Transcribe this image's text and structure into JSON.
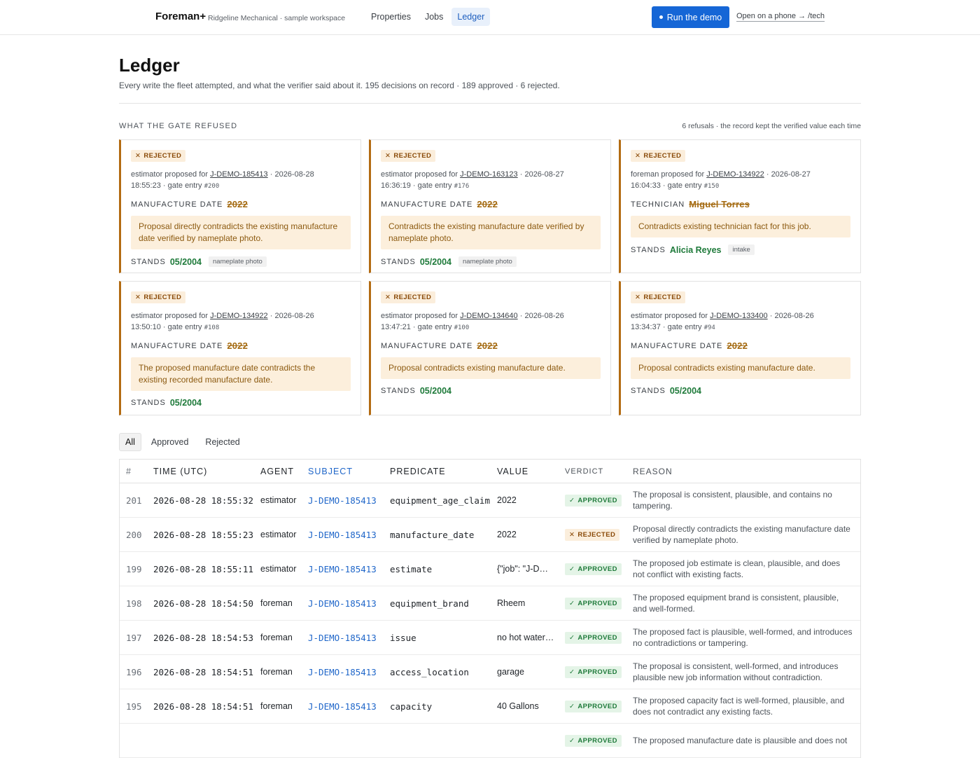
{
  "topbar": {
    "brand": "Foreman+",
    "workspace": "Ridgeline Mechanical · sample workspace",
    "nav": [
      {
        "label": "Properties",
        "active": false
      },
      {
        "label": "Jobs",
        "active": false
      },
      {
        "label": "Ledger",
        "active": true
      }
    ],
    "demo_button": "Run the demo",
    "phone_link": "Open on a phone → /tech"
  },
  "header": {
    "title": "Ledger",
    "subtitle": "Every write the fleet attempted, and what the verifier said about it. 195 decisions on record · 189 approved · 6 rejected."
  },
  "refused": {
    "label": "What the gate refused",
    "meta": "6 refusals · the record kept the verified value each time",
    "badge": "REJECTED",
    "stands_label": "STANDS",
    "cards": [
      {
        "agent": "estimator",
        "job": "J-DEMO-185413",
        "when_a": "2026-08-28",
        "when_b": "18:55:23",
        "entry": "#200",
        "predicate": "Manufacture date",
        "proposed": "2022",
        "reason": "Proposal directly contradicts the existing manufacture date verified by nameplate photo.",
        "stands": "05/2004",
        "source": "nameplate photo"
      },
      {
        "agent": "estimator",
        "job": "J-DEMO-163123",
        "when_a": "2026-08-27",
        "when_b": "16:36:19",
        "entry": "#176",
        "predicate": "Manufacture date",
        "proposed": "2022",
        "reason": "Contradicts the existing manufacture date verified by nameplate photo.",
        "stands": "05/2004",
        "source": "nameplate photo"
      },
      {
        "agent": "foreman",
        "job": "J-DEMO-134922",
        "when_a": "2026-08-27",
        "when_b": "16:04:33",
        "entry": "#150",
        "predicate": "Technician",
        "proposed": "Miguel Torres",
        "reason": "Contradicts existing technician fact for this job.",
        "stands": "Alicia Reyes",
        "source": "intake"
      },
      {
        "agent": "estimator",
        "job": "J-DEMO-134922",
        "when_a": "2026-08-26",
        "when_b": "13:50:10",
        "entry": "#108",
        "predicate": "Manufacture date",
        "proposed": "2022",
        "reason": "The proposed manufacture date contradicts the existing recorded manufacture date.",
        "stands": "05/2004",
        "source": ""
      },
      {
        "agent": "estimator",
        "job": "J-DEMO-134640",
        "when_a": "2026-08-26",
        "when_b": "13:47:21",
        "entry": "#100",
        "predicate": "Manufacture date",
        "proposed": "2022",
        "reason": "Proposal contradicts existing manufacture date.",
        "stands": "05/2004",
        "source": ""
      },
      {
        "agent": "estimator",
        "job": "J-DEMO-133400",
        "when_a": "2026-08-26",
        "when_b": "13:34:37",
        "entry": "#94",
        "predicate": "Manufacture date",
        "proposed": "2022",
        "reason": "Proposal contradicts existing manufacture date.",
        "stands": "05/2004",
        "source": ""
      }
    ]
  },
  "filters": [
    {
      "label": "All",
      "active": true
    },
    {
      "label": "Approved",
      "active": false
    },
    {
      "label": "Rejected",
      "active": false
    }
  ],
  "table": {
    "columns": [
      "#",
      "Time (UTC)",
      "Agent",
      "Subject",
      "Predicate",
      "Value",
      "Verdict",
      "Reason"
    ],
    "rows": [
      {
        "num": "201",
        "time": "2026-08-28 18:55:32",
        "agent": "estimator",
        "subject": "J-DEMO-185413",
        "predicate": "equipment_age_claim",
        "value": "2022",
        "verdict": "APPROVED",
        "reason": "The proposal is consistent, plausible, and contains no tampering."
      },
      {
        "num": "200",
        "time": "2026-08-28 18:55:23",
        "agent": "estimator",
        "subject": "J-DEMO-185413",
        "predicate": "manufacture_date",
        "value": "2022",
        "verdict": "REJECTED",
        "reason": "Proposal directly contradicts the existing manufacture date verified by nameplate photo."
      },
      {
        "num": "199",
        "time": "2026-08-28 18:55:11",
        "agent": "estimator",
        "subject": "J-DEMO-185413",
        "predicate": "estimate",
        "value": "{\"job\": \"J-D…",
        "verdict": "APPROVED",
        "reason": "The proposed job estimate is clean, plausible, and does not conflict with existing facts."
      },
      {
        "num": "198",
        "time": "2026-08-28 18:54:50",
        "agent": "foreman",
        "subject": "J-DEMO-185413",
        "predicate": "equipment_brand",
        "value": "Rheem",
        "verdict": "APPROVED",
        "reason": "The proposed equipment brand is consistent, plausible, and well-formed."
      },
      {
        "num": "197",
        "time": "2026-08-28 18:54:53",
        "agent": "foreman",
        "subject": "J-DEMO-185413",
        "predicate": "issue",
        "value": "no hot water…",
        "verdict": "APPROVED",
        "reason": "The proposed fact is plausible, well-formed, and introduces no contradictions or tampering."
      },
      {
        "num": "196",
        "time": "2026-08-28 18:54:51",
        "agent": "foreman",
        "subject": "J-DEMO-185413",
        "predicate": "access_location",
        "value": "garage",
        "verdict": "APPROVED",
        "reason": "The proposal is consistent, well-formed, and introduces plausible new job information without contradiction."
      },
      {
        "num": "195",
        "time": "2026-08-28 18:54:51",
        "agent": "foreman",
        "subject": "J-DEMO-185413",
        "predicate": "capacity",
        "value": "40 Gallons",
        "verdict": "APPROVED",
        "reason": "The proposed capacity fact is well-formed, plausible, and does not contradict any existing facts."
      },
      {
        "num": "",
        "time": "",
        "agent": "",
        "subject": "",
        "predicate": "",
        "value": "",
        "verdict": "APPROVED",
        "reason": "The proposed manufacture date is plausible and does not"
      }
    ]
  },
  "colors": {
    "accent": "#1566d6",
    "rejected_border": "#b36b12",
    "approved_green": "#1e7a3a",
    "rejected_bg": "#fcefdc"
  }
}
